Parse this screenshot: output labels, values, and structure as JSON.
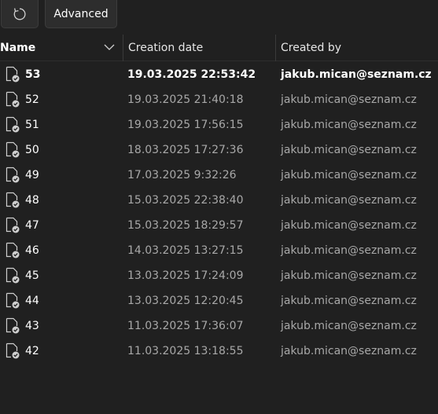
{
  "toolbar": {
    "refresh_icon": "refresh-icon",
    "advanced_label": "Advanced"
  },
  "columns": {
    "name": "Name",
    "creation_date": "Creation date",
    "created_by": "Created by",
    "sort_icon": "chevron-down-icon"
  },
  "rows": [
    {
      "name": "53",
      "date": "19.03.2025 22:53:42",
      "by": "jakub.mican@seznam.cz",
      "bold": true
    },
    {
      "name": "52",
      "date": "19.03.2025 21:40:18",
      "by": "jakub.mican@seznam.cz",
      "bold": false
    },
    {
      "name": "51",
      "date": "19.03.2025 17:56:15",
      "by": "jakub.mican@seznam.cz",
      "bold": false
    },
    {
      "name": "50",
      "date": "18.03.2025 17:27:36",
      "by": "jakub.mican@seznam.cz",
      "bold": false
    },
    {
      "name": "49",
      "date": "17.03.2025 9:32:26",
      "by": "jakub.mican@seznam.cz",
      "bold": false
    },
    {
      "name": "48",
      "date": "15.03.2025 22:38:40",
      "by": "jakub.mican@seznam.cz",
      "bold": false
    },
    {
      "name": "47",
      "date": "15.03.2025 18:29:57",
      "by": "jakub.mican@seznam.cz",
      "bold": false
    },
    {
      "name": "46",
      "date": "14.03.2025 13:27:15",
      "by": "jakub.mican@seznam.cz",
      "bold": false
    },
    {
      "name": "45",
      "date": "13.03.2025 17:24:09",
      "by": "jakub.mican@seznam.cz",
      "bold": false
    },
    {
      "name": "44",
      "date": "13.03.2025 12:20:45",
      "by": "jakub.mican@seznam.cz",
      "bold": false
    },
    {
      "name": "43",
      "date": "11.03.2025 17:36:07",
      "by": "jakub.mican@seznam.cz",
      "bold": false
    },
    {
      "name": "42",
      "date": "11.03.2025 13:18:55",
      "by": "jakub.mican@seznam.cz",
      "bold": false
    }
  ],
  "colors": {
    "background": "#202020",
    "button_bg": "#2d2d2d",
    "text_primary": "#ffffff",
    "text_secondary": "#a8a8a8"
  }
}
